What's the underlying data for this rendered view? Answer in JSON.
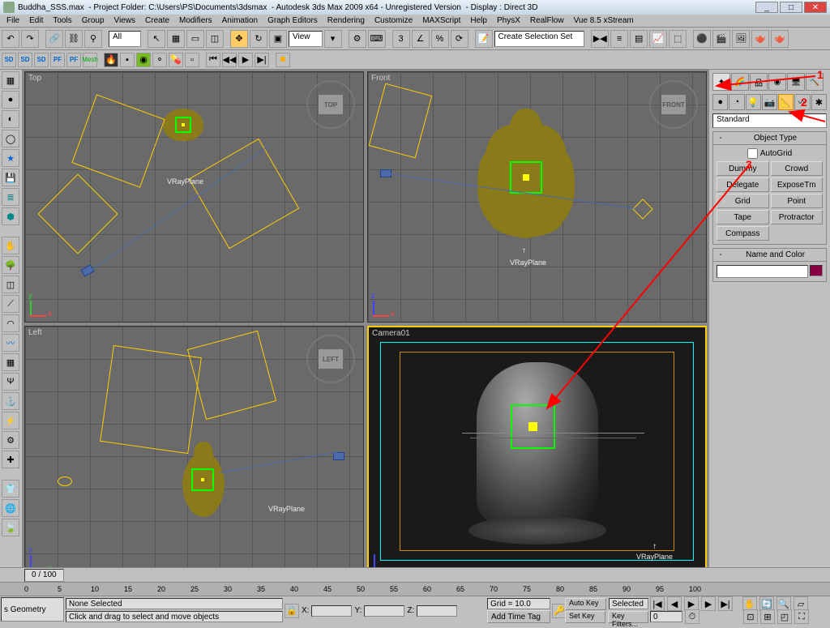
{
  "title": {
    "file": "Buddha_SSS.max",
    "folder": "- Project Folder: C:\\Users\\PS\\Documents\\3dsmax",
    "app": "- Autodesk 3ds Max  2009 x64  - Unregistered Version",
    "display": "- Display : Direct 3D"
  },
  "menu": [
    "File",
    "Edit",
    "Tools",
    "Group",
    "Views",
    "Create",
    "Modifiers",
    "Animation",
    "Graph Editors",
    "Rendering",
    "Customize",
    "MAXScript",
    "Help",
    "PhysX",
    "RealFlow",
    "Vue 8.5 xStream"
  ],
  "toolbar": {
    "all": "All",
    "view": "View",
    "selset": "Create Selection Set"
  },
  "viewports": {
    "top": "Top",
    "front": "Front",
    "left": "Left",
    "camera": "Camera01",
    "plane": "VRayPlane",
    "cube_top": "TOP",
    "cube_front": "FRONT",
    "cube_left": "LEFT"
  },
  "panel": {
    "standard": "Standard",
    "objtype": "Object Type",
    "autogrid": "AutoGrid",
    "buttons": {
      "dummy": "Dummy",
      "crowd": "Crowd",
      "delegate": "Delegate",
      "exposetm": "ExposeTm",
      "grid": "Grid",
      "point": "Point",
      "tape": "Tape",
      "protractor": "Protractor",
      "compass": "Compass"
    },
    "namecolor": "Name and Color"
  },
  "timeline": {
    "scrub": "0 / 100",
    "ticks": [
      "0",
      "5",
      "10",
      "15",
      "20",
      "25",
      "30",
      "35",
      "40",
      "45",
      "50",
      "55",
      "60",
      "65",
      "70",
      "75",
      "80",
      "85",
      "90",
      "95",
      "100"
    ]
  },
  "status": {
    "geo": "s Geometry",
    "none": "None Selected",
    "prompt": "Click and drag to select and move objects",
    "x": "X:",
    "y": "Y:",
    "z": "Z:",
    "grid": "Grid = 10.0",
    "addtag": "Add Time Tag",
    "autokey": "Auto Key",
    "setkey": "Set Key",
    "selected": "Selected",
    "keyfilters": "Key Filters..."
  },
  "annot": {
    "n1": "1",
    "n2": "2",
    "n3": "3"
  }
}
